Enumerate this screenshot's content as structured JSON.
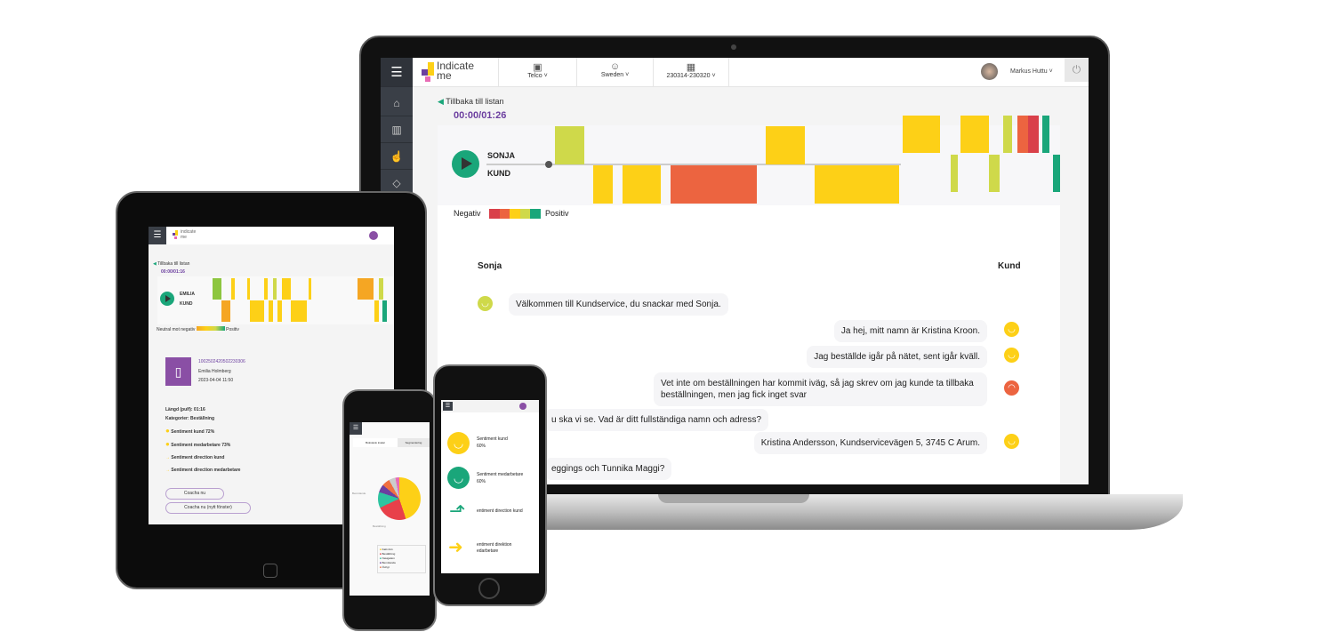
{
  "laptop": {
    "logo": {
      "line1": "Indicate",
      "line2": "me"
    },
    "filters": [
      {
        "label": "Telco",
        "icon": "briefcase-icon"
      },
      {
        "label": "Sweden",
        "icon": "people-icon"
      },
      {
        "label": "230314-230320",
        "icon": "calendar-icon"
      }
    ],
    "user": {
      "name": "Markus Huttu"
    },
    "sidebar": [
      "home-icon",
      "chart-icon",
      "thumbs-up-icon",
      "diamond-icon"
    ],
    "back_link": "Tillbaka till listan",
    "time": "00:00/01:26",
    "speakers": {
      "agent": "SONJA",
      "customer": "KUND"
    },
    "legend": {
      "negative": "Negativ",
      "positive": "Positiv"
    },
    "colors": {
      "very_negative": "#d9404a",
      "negative": "#ec6440",
      "neutral": "#fdd017",
      "positive": "#cfd94a",
      "very_positive": "#1aa67a",
      "accent": "#6c3fa0"
    },
    "chat": {
      "agent_header": "Sonja",
      "customer_header": "Kund",
      "messages": [
        {
          "from": "agent",
          "text": "Välkommen till Kundservice, du snackar med Sonja.",
          "sentiment": "positive"
        },
        {
          "from": "customer",
          "text": "Ja hej, mitt namn är Kristina Kroon.",
          "sentiment": "neutral"
        },
        {
          "from": "customer",
          "text": "Jag beställde igår på nätet, sent igår kväll.",
          "sentiment": "neutral"
        },
        {
          "from": "customer",
          "text": "Vet inte om beställningen har kommit iväg, så jag skrev om jag kunde ta tillbaka beställningen, men jag fick inget svar",
          "sentiment": "negative"
        },
        {
          "from": "agent",
          "text": "u ska vi se. Vad är ditt fullständiga namn och adress?"
        },
        {
          "from": "customer",
          "text": "Kristina Andersson, Kundservicevägen 5, 3745 C Arum.",
          "sentiment": "neutral"
        },
        {
          "from": "agent",
          "text": "eggings och Tunnika Maggi?"
        }
      ]
    }
  },
  "tablet": {
    "logo": {
      "line1": "indicate",
      "line2": "me"
    },
    "back_link": "Tillbaka till listan",
    "time": "00:00/01:16",
    "speakers": {
      "agent": "EMILIA",
      "customer": "KUND"
    },
    "legend": {
      "negative": "Neutral mot negativ",
      "positive": "Positiv"
    },
    "call": {
      "id": "1002502420502230306",
      "agent": "Emilia Holmberg",
      "datetime": "2023-04-04 11:50"
    },
    "details": {
      "length": "Längd (pulf): 01:16",
      "category": "Kategorier: Beställning"
    },
    "metrics": [
      "Sentiment kund 72%",
      "Sentiment medarbetare 73%",
      "Sentiment direction kund",
      "Sentiment direction medarbetare"
    ],
    "buttons": [
      "Coacha nu",
      "Coacha nu (nytt fönster)"
    ]
  },
  "phone_left": {
    "tabs": [
      "Bokstavlo kvalar",
      "Segmentering"
    ],
    "chart_labels": [
      "Bemötande",
      "Beställning"
    ],
    "legend": [
      "Fakt./Avt.",
      "Beställning",
      "Navigation",
      "Bemötande",
      "Övrigt"
    ]
  },
  "phone_right": {
    "metrics": [
      {
        "label": "Sentiment kund",
        "value": "60%"
      },
      {
        "label": "Sentiment medarbetare",
        "value": "60%"
      },
      {
        "label": "entiment direction kund"
      },
      {
        "label": "entiment direktion \nedarbetare"
      }
    ]
  }
}
